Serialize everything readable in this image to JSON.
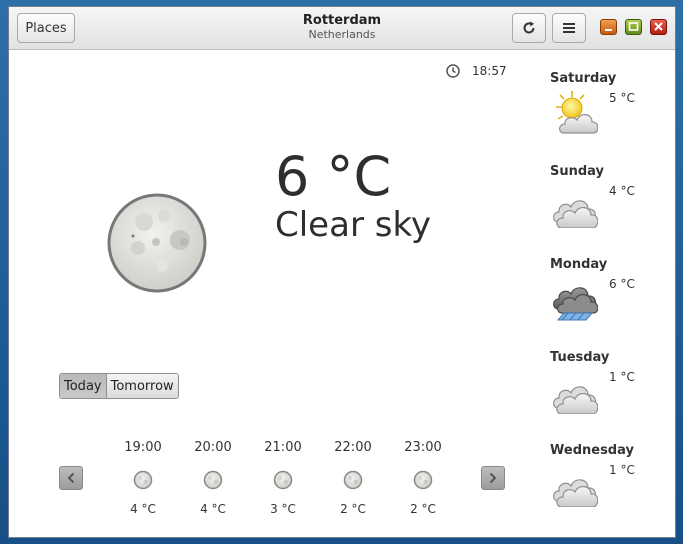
{
  "titlebar": {
    "places_label": "Places",
    "city": "Rotterdam",
    "country": "Netherlands"
  },
  "current": {
    "time": "18:57",
    "temperature": "6 °C",
    "condition": "Clear sky"
  },
  "toggle": {
    "today": "Today",
    "tomorrow": "Tomorrow"
  },
  "hourly": [
    {
      "time": "19:00",
      "temp": "4 °C"
    },
    {
      "time": "20:00",
      "temp": "4 °C"
    },
    {
      "time": "21:00",
      "temp": "3 °C"
    },
    {
      "time": "22:00",
      "temp": "2 °C"
    },
    {
      "time": "23:00",
      "temp": "2 °C"
    }
  ],
  "forecast": [
    {
      "day": "Saturday",
      "temp": "5 °C",
      "icon": "sun-behind-cloud-icon"
    },
    {
      "day": "Sunday",
      "temp": "4 °C",
      "icon": "cloudy-icon"
    },
    {
      "day": "Monday",
      "temp": "6 °C",
      "icon": "rain-icon"
    },
    {
      "day": "Tuesday",
      "temp": "1 °C",
      "icon": "cloudy-icon"
    },
    {
      "day": "Wednesday",
      "temp": "1 °C",
      "icon": "cloudy-icon"
    }
  ]
}
